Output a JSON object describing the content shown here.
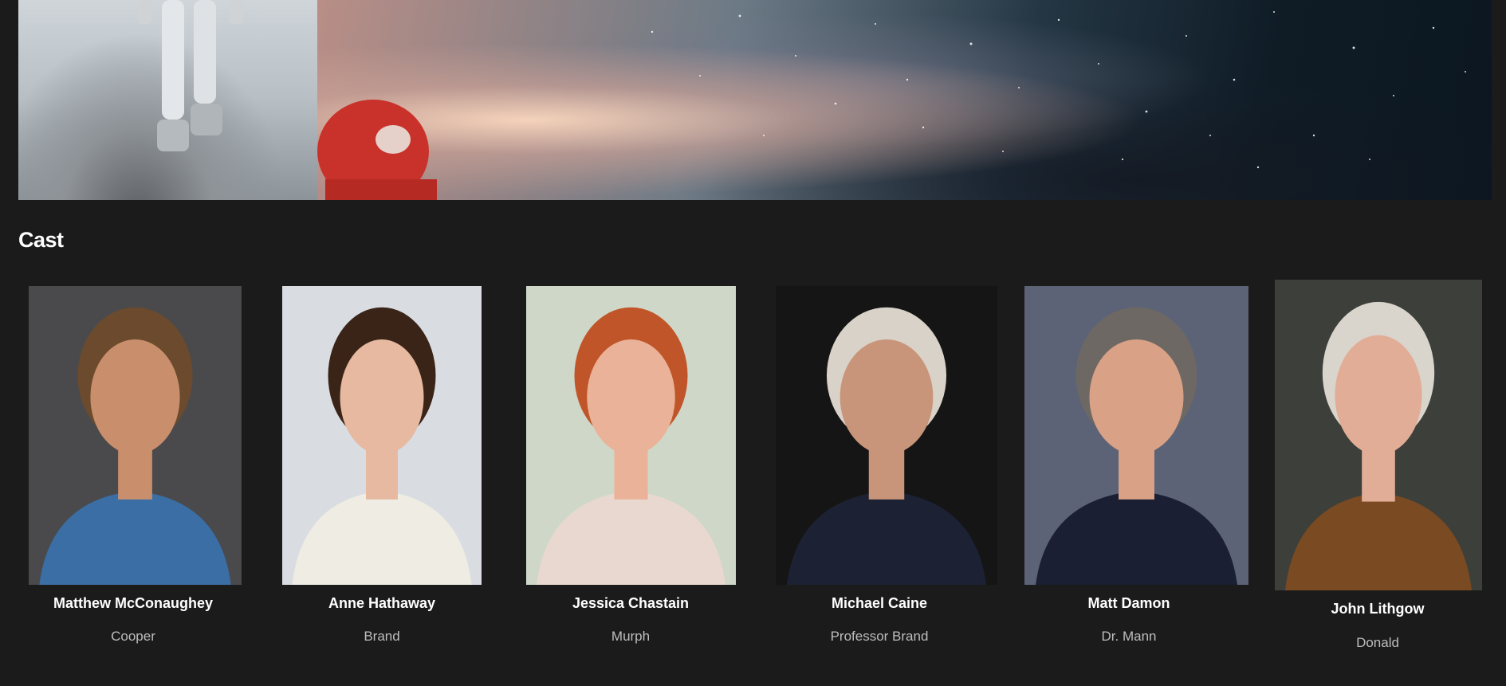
{
  "section": {
    "title": "Cast"
  },
  "cast": [
    {
      "actor": "Matthew McConaughey",
      "character": "Cooper",
      "bg": "#4a4a4c",
      "skin": "#c98f6c",
      "hair": "#6b4a2e",
      "shirt": "#3a6ea5"
    },
    {
      "actor": "Anne Hathaway",
      "character": "Brand",
      "bg": "#d9dde2",
      "skin": "#e6b9a0",
      "hair": "#3a2418",
      "shirt": "#efece4"
    },
    {
      "actor": "Jessica Chastain",
      "character": "Murph",
      "bg": "#cfd8c8",
      "skin": "#eab298",
      "hair": "#c0552a",
      "shirt": "#e9d8cf"
    },
    {
      "actor": "Michael Caine",
      "character": "Professor Brand",
      "bg": "#151515",
      "skin": "#c9957a",
      "hair": "#d8d2c8",
      "shirt": "#1c2233"
    },
    {
      "actor": "Matt Damon",
      "character": "Dr. Mann",
      "bg": "#5c6377",
      "skin": "#d9a186",
      "hair": "#6d6863",
      "shirt": "#1a1f33"
    },
    {
      "actor": "John Lithgow",
      "character": "Donald",
      "bg": "#3c3f3a",
      "skin": "#e2ad96",
      "hair": "#d9d5cd",
      "shirt": "#7a4a22"
    }
  ]
}
